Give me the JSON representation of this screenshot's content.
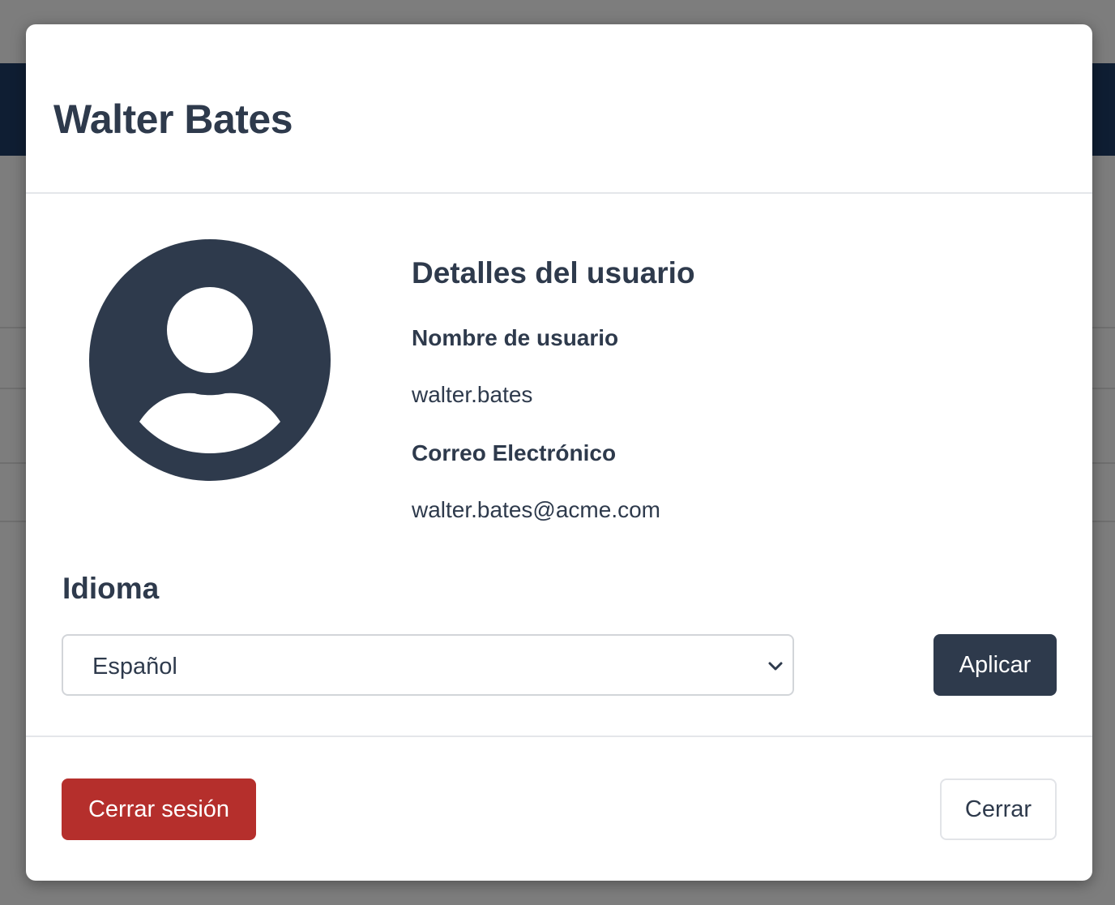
{
  "modal": {
    "title": "Walter Bates"
  },
  "details": {
    "heading": "Detalles del usuario",
    "username_label": "Nombre de usuario",
    "username_value": "walter.bates",
    "email_label": "Correo Electrónico",
    "email_value": "walter.bates@acme.com"
  },
  "language": {
    "heading": "Idioma",
    "selected": "Español",
    "apply_label": "Aplicar"
  },
  "footer": {
    "logout_label": "Cerrar sesión",
    "close_label": "Cerrar"
  },
  "icons": {
    "avatar": "user-circle-icon",
    "select_chevron": "chevron-down-icon"
  },
  "colors": {
    "primary": "#2e3a4c",
    "danger": "#b52f2c",
    "background_navbar": "#0f1e33"
  }
}
